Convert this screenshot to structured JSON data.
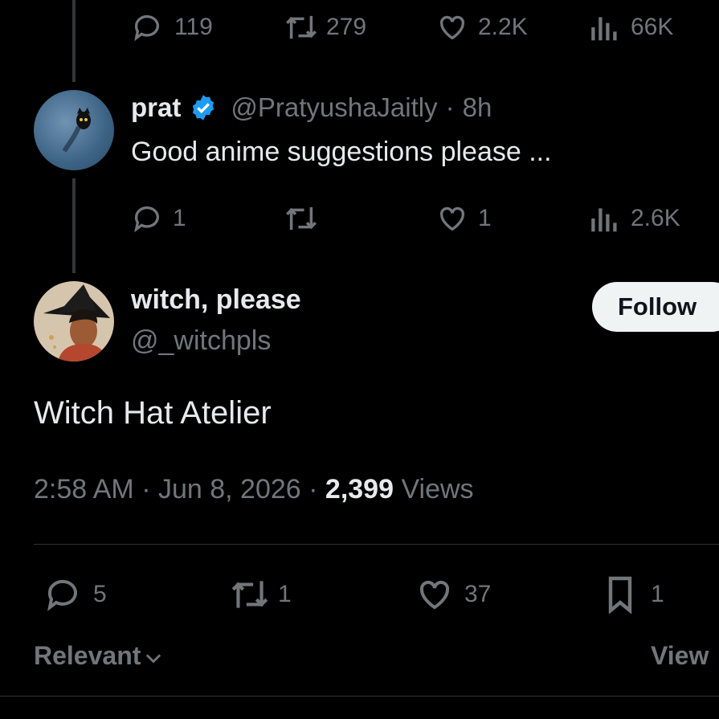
{
  "top_tweet_actions": {
    "replies": "119",
    "reposts": "279",
    "likes": "2.2K",
    "views": "66K"
  },
  "reply_tweet": {
    "display_name": "prat",
    "verified": true,
    "handle": "@PratyushaJaitly",
    "separator": "·",
    "time": "8h",
    "text": "Good anime suggestions please ...",
    "actions": {
      "replies": "1",
      "reposts": "",
      "likes": "1",
      "views": "2.6K"
    }
  },
  "main_tweet": {
    "display_name": "witch, please",
    "handle": "@_witchpls",
    "follow_label": "Follow",
    "text": "Witch Hat Atelier",
    "time": "2:58 AM",
    "dot1": "·",
    "date": "Jun 8, 2026",
    "dot2": "·",
    "views_count": "2,399",
    "views_label": "Views",
    "actions": {
      "replies": "5",
      "reposts": "1",
      "likes": "37",
      "bookmarks": "1"
    }
  },
  "sort": {
    "label": "Relevant",
    "view_label": "View"
  },
  "colors": {
    "background": "#000000",
    "text": "#e7e9ea",
    "muted": "#71767b",
    "verified": "#1d9bf0",
    "divider": "#2f3336"
  },
  "icons": [
    "reply-icon",
    "repost-icon",
    "like-icon",
    "views-icon",
    "bookmark-icon",
    "verified-icon",
    "chevron-down-icon"
  ]
}
